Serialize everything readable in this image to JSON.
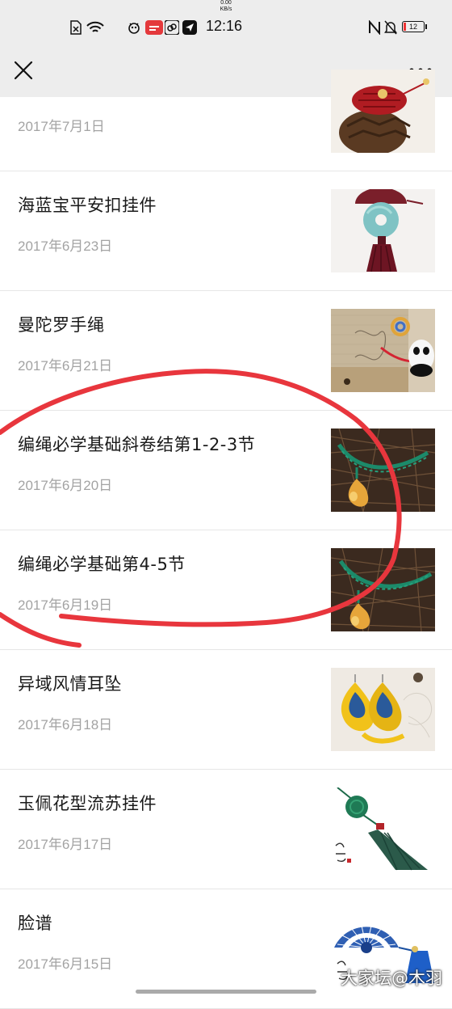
{
  "status_bar": {
    "speed_value": "0.00",
    "speed_unit": "KB/s",
    "time": "12:16",
    "battery": "12"
  },
  "articles": [
    {
      "title": "",
      "date": "2017年7月1日",
      "thumb": "pinecone-knot-thumbnail"
    },
    {
      "title": "海蓝宝平安扣挂件",
      "date": "2017年6月23日",
      "thumb": "aquamarine-pendant-thumbnail"
    },
    {
      "title": "曼陀罗手绳",
      "date": "2017年6月21日",
      "thumb": "panda-bracelet-thumbnail"
    },
    {
      "title": "编绳必学基础斜卷结第1-2-3节",
      "date": "2017年6月20日",
      "thumb": "macrame-necklace-thumbnail"
    },
    {
      "title": "编绳必学基础第4-5节",
      "date": "2017年6月19日",
      "thumb": "macrame-necklace-thumbnail"
    },
    {
      "title": "异域风情耳坠",
      "date": "2017年6月18日",
      "thumb": "yellow-earrings-thumbnail"
    },
    {
      "title": "玉佩花型流苏挂件",
      "date": "2017年6月17日",
      "thumb": "green-tassel-thumbnail"
    },
    {
      "title": "脸谱",
      "date": "2017年6月15日",
      "thumb": "blue-fan-tassel-thumbnail"
    }
  ],
  "watermark": "大家坛@木羽",
  "colors": {
    "status_bg": "#ededed",
    "title": "#1a1a1a",
    "date": "#a3a3a3",
    "annotation": "#e8363d"
  }
}
